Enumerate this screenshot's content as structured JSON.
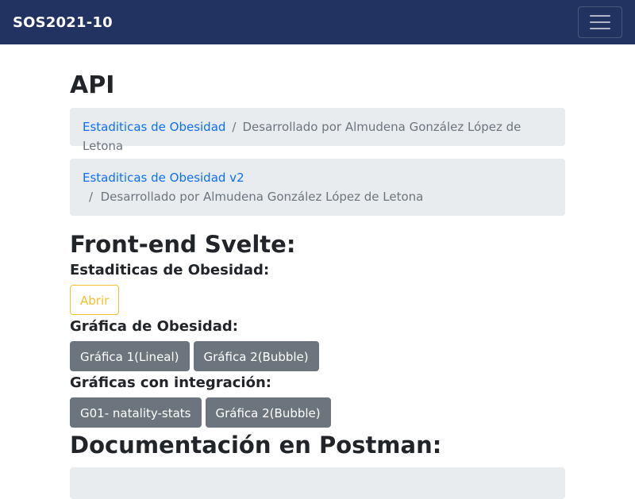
{
  "navbar": {
    "brand": "SOS2021-10",
    "toggler_icon": "hamburger-menu-icon"
  },
  "main": {
    "title": "API",
    "breadcrumb1": {
      "link": "Estaditicas de Obesidad",
      "separator": "/",
      "text": "Desarrollado por Almudena González López de Letona"
    },
    "breadcrumb2": {
      "link": "Estaditicas de Obesidad v2",
      "separator": "/",
      "text": "Desarrollado por Almudena González López de Letona"
    },
    "frontend": {
      "heading": "Front-end Svelte:",
      "stats_label": "Estaditicas de Obesidad:",
      "open_button": "Abrir",
      "graphs_label": "Gráfica de Obesidad:",
      "graph_buttons": [
        "Gráfica 1(Lineal)",
        "Gráfica 2(Bubble)"
      ],
      "integration_label": "Gráficas con integración:",
      "integration_buttons": [
        "G01- natality-stats",
        "Gráfica 2(Bubble)"
      ]
    },
    "docs": {
      "heading": "Documentación en Postman:"
    }
  },
  "colors": {
    "navbar_bg": "#223361",
    "link": "#0d6efd",
    "warning": "#f2c12e",
    "secondary": "#6c757d",
    "breadcrumb_bg": "#e9ecef"
  }
}
